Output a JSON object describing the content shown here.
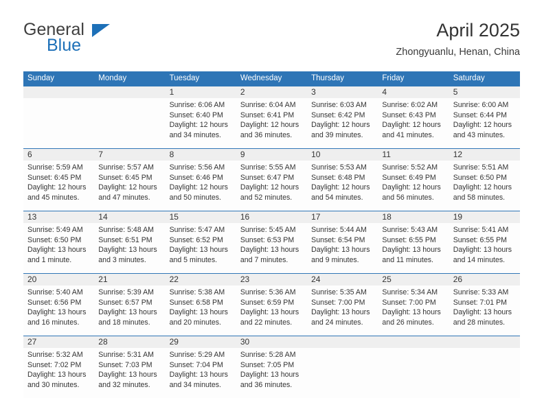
{
  "brand": {
    "line1": "General",
    "line2": "Blue",
    "triangle_color": "#1d70b8",
    "text_color": "#3f3f3f"
  },
  "header": {
    "title": "April 2025",
    "subtitle": "Zhongyuanlu, Henan, China"
  },
  "theme": {
    "header_blue": "#2e75b6",
    "day_band_gray": "#efefef",
    "cell_bg": "#fdfdfd",
    "text": "#333333"
  },
  "labels": {
    "sunrise_prefix": "Sunrise:",
    "sunset_prefix": "Sunset:",
    "daylight_prefix": "Daylight:"
  },
  "day_headers": [
    "Sunday",
    "Monday",
    "Tuesday",
    "Wednesday",
    "Thursday",
    "Friday",
    "Saturday"
  ],
  "weeks": [
    [
      {
        "day": "",
        "sunrise": "",
        "sunset": "",
        "daylight_l1": "",
        "daylight_l2": ""
      },
      {
        "day": "",
        "sunrise": "",
        "sunset": "",
        "daylight_l1": "",
        "daylight_l2": ""
      },
      {
        "day": "1",
        "sunrise": "Sunrise: 6:06 AM",
        "sunset": "Sunset: 6:40 PM",
        "daylight_l1": "Daylight: 12 hours",
        "daylight_l2": "and 34 minutes."
      },
      {
        "day": "2",
        "sunrise": "Sunrise: 6:04 AM",
        "sunset": "Sunset: 6:41 PM",
        "daylight_l1": "Daylight: 12 hours",
        "daylight_l2": "and 36 minutes."
      },
      {
        "day": "3",
        "sunrise": "Sunrise: 6:03 AM",
        "sunset": "Sunset: 6:42 PM",
        "daylight_l1": "Daylight: 12 hours",
        "daylight_l2": "and 39 minutes."
      },
      {
        "day": "4",
        "sunrise": "Sunrise: 6:02 AM",
        "sunset": "Sunset: 6:43 PM",
        "daylight_l1": "Daylight: 12 hours",
        "daylight_l2": "and 41 minutes."
      },
      {
        "day": "5",
        "sunrise": "Sunrise: 6:00 AM",
        "sunset": "Sunset: 6:44 PM",
        "daylight_l1": "Daylight: 12 hours",
        "daylight_l2": "and 43 minutes."
      }
    ],
    [
      {
        "day": "6",
        "sunrise": "Sunrise: 5:59 AM",
        "sunset": "Sunset: 6:45 PM",
        "daylight_l1": "Daylight: 12 hours",
        "daylight_l2": "and 45 minutes."
      },
      {
        "day": "7",
        "sunrise": "Sunrise: 5:57 AM",
        "sunset": "Sunset: 6:45 PM",
        "daylight_l1": "Daylight: 12 hours",
        "daylight_l2": "and 47 minutes."
      },
      {
        "day": "8",
        "sunrise": "Sunrise: 5:56 AM",
        "sunset": "Sunset: 6:46 PM",
        "daylight_l1": "Daylight: 12 hours",
        "daylight_l2": "and 50 minutes."
      },
      {
        "day": "9",
        "sunrise": "Sunrise: 5:55 AM",
        "sunset": "Sunset: 6:47 PM",
        "daylight_l1": "Daylight: 12 hours",
        "daylight_l2": "and 52 minutes."
      },
      {
        "day": "10",
        "sunrise": "Sunrise: 5:53 AM",
        "sunset": "Sunset: 6:48 PM",
        "daylight_l1": "Daylight: 12 hours",
        "daylight_l2": "and 54 minutes."
      },
      {
        "day": "11",
        "sunrise": "Sunrise: 5:52 AM",
        "sunset": "Sunset: 6:49 PM",
        "daylight_l1": "Daylight: 12 hours",
        "daylight_l2": "and 56 minutes."
      },
      {
        "day": "12",
        "sunrise": "Sunrise: 5:51 AM",
        "sunset": "Sunset: 6:50 PM",
        "daylight_l1": "Daylight: 12 hours",
        "daylight_l2": "and 58 minutes."
      }
    ],
    [
      {
        "day": "13",
        "sunrise": "Sunrise: 5:49 AM",
        "sunset": "Sunset: 6:50 PM",
        "daylight_l1": "Daylight: 13 hours",
        "daylight_l2": "and 1 minute."
      },
      {
        "day": "14",
        "sunrise": "Sunrise: 5:48 AM",
        "sunset": "Sunset: 6:51 PM",
        "daylight_l1": "Daylight: 13 hours",
        "daylight_l2": "and 3 minutes."
      },
      {
        "day": "15",
        "sunrise": "Sunrise: 5:47 AM",
        "sunset": "Sunset: 6:52 PM",
        "daylight_l1": "Daylight: 13 hours",
        "daylight_l2": "and 5 minutes."
      },
      {
        "day": "16",
        "sunrise": "Sunrise: 5:45 AM",
        "sunset": "Sunset: 6:53 PM",
        "daylight_l1": "Daylight: 13 hours",
        "daylight_l2": "and 7 minutes."
      },
      {
        "day": "17",
        "sunrise": "Sunrise: 5:44 AM",
        "sunset": "Sunset: 6:54 PM",
        "daylight_l1": "Daylight: 13 hours",
        "daylight_l2": "and 9 minutes."
      },
      {
        "day": "18",
        "sunrise": "Sunrise: 5:43 AM",
        "sunset": "Sunset: 6:55 PM",
        "daylight_l1": "Daylight: 13 hours",
        "daylight_l2": "and 11 minutes."
      },
      {
        "day": "19",
        "sunrise": "Sunrise: 5:41 AM",
        "sunset": "Sunset: 6:55 PM",
        "daylight_l1": "Daylight: 13 hours",
        "daylight_l2": "and 14 minutes."
      }
    ],
    [
      {
        "day": "20",
        "sunrise": "Sunrise: 5:40 AM",
        "sunset": "Sunset: 6:56 PM",
        "daylight_l1": "Daylight: 13 hours",
        "daylight_l2": "and 16 minutes."
      },
      {
        "day": "21",
        "sunrise": "Sunrise: 5:39 AM",
        "sunset": "Sunset: 6:57 PM",
        "daylight_l1": "Daylight: 13 hours",
        "daylight_l2": "and 18 minutes."
      },
      {
        "day": "22",
        "sunrise": "Sunrise: 5:38 AM",
        "sunset": "Sunset: 6:58 PM",
        "daylight_l1": "Daylight: 13 hours",
        "daylight_l2": "and 20 minutes."
      },
      {
        "day": "23",
        "sunrise": "Sunrise: 5:36 AM",
        "sunset": "Sunset: 6:59 PM",
        "daylight_l1": "Daylight: 13 hours",
        "daylight_l2": "and 22 minutes."
      },
      {
        "day": "24",
        "sunrise": "Sunrise: 5:35 AM",
        "sunset": "Sunset: 7:00 PM",
        "daylight_l1": "Daylight: 13 hours",
        "daylight_l2": "and 24 minutes."
      },
      {
        "day": "25",
        "sunrise": "Sunrise: 5:34 AM",
        "sunset": "Sunset: 7:00 PM",
        "daylight_l1": "Daylight: 13 hours",
        "daylight_l2": "and 26 minutes."
      },
      {
        "day": "26",
        "sunrise": "Sunrise: 5:33 AM",
        "sunset": "Sunset: 7:01 PM",
        "daylight_l1": "Daylight: 13 hours",
        "daylight_l2": "and 28 minutes."
      }
    ],
    [
      {
        "day": "27",
        "sunrise": "Sunrise: 5:32 AM",
        "sunset": "Sunset: 7:02 PM",
        "daylight_l1": "Daylight: 13 hours",
        "daylight_l2": "and 30 minutes."
      },
      {
        "day": "28",
        "sunrise": "Sunrise: 5:31 AM",
        "sunset": "Sunset: 7:03 PM",
        "daylight_l1": "Daylight: 13 hours",
        "daylight_l2": "and 32 minutes."
      },
      {
        "day": "29",
        "sunrise": "Sunrise: 5:29 AM",
        "sunset": "Sunset: 7:04 PM",
        "daylight_l1": "Daylight: 13 hours",
        "daylight_l2": "and 34 minutes."
      },
      {
        "day": "30",
        "sunrise": "Sunrise: 5:28 AM",
        "sunset": "Sunset: 7:05 PM",
        "daylight_l1": "Daylight: 13 hours",
        "daylight_l2": "and 36 minutes."
      },
      {
        "day": "",
        "sunrise": "",
        "sunset": "",
        "daylight_l1": "",
        "daylight_l2": ""
      },
      {
        "day": "",
        "sunrise": "",
        "sunset": "",
        "daylight_l1": "",
        "daylight_l2": ""
      },
      {
        "day": "",
        "sunrise": "",
        "sunset": "",
        "daylight_l1": "",
        "daylight_l2": ""
      }
    ]
  ]
}
